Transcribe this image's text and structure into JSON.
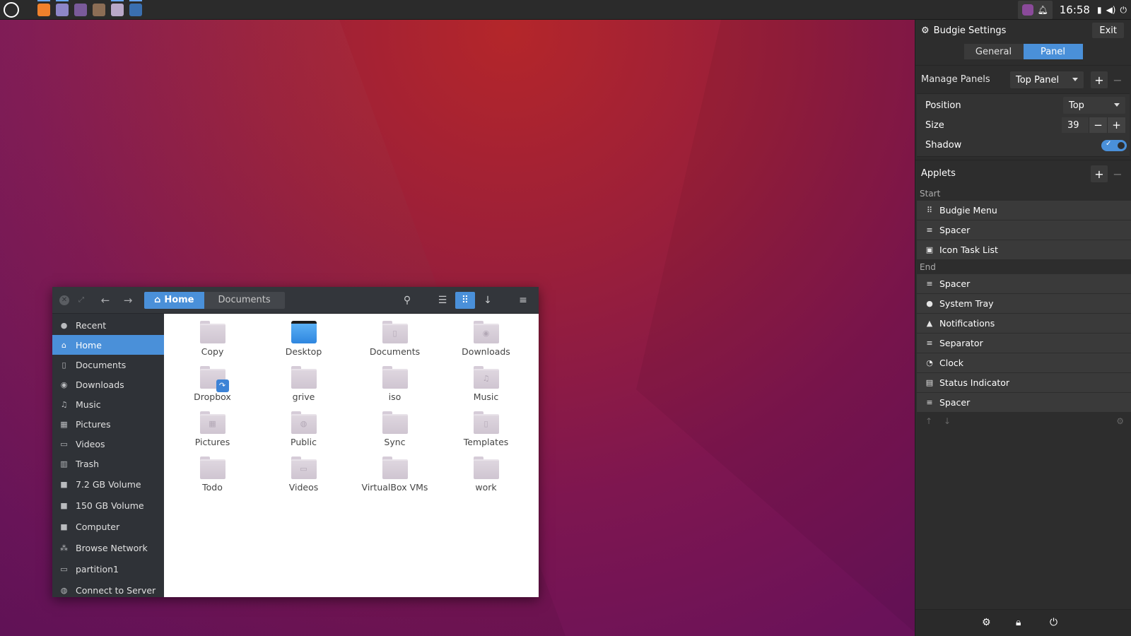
{
  "top_panel": {
    "clock": "16:58",
    "task_icons": [
      {
        "name": "firefox-icon",
        "color": "#f0812c",
        "active": true
      },
      {
        "name": "text-editor-icon",
        "color": "#8e86c8",
        "active": true
      },
      {
        "name": "pidgin-icon",
        "color": "#7a5a9a",
        "active": false
      },
      {
        "name": "photo-app-icon",
        "color": "#8c6d55",
        "active": false
      },
      {
        "name": "file-manager-icon",
        "color": "#b9a8c8",
        "active": true
      },
      {
        "name": "virtualbox-icon",
        "color": "#3a6fb0",
        "active": true
      }
    ]
  },
  "file_manager": {
    "path": {
      "home": "Home",
      "current": "Documents"
    },
    "sidebar": [
      {
        "label": "Recent",
        "icon": "recent-icon",
        "glyph": "●"
      },
      {
        "label": "Home",
        "icon": "home-icon",
        "glyph": "⌂",
        "selected": true
      },
      {
        "label": "Documents",
        "icon": "document-icon",
        "glyph": "▯"
      },
      {
        "label": "Downloads",
        "icon": "download-icon",
        "glyph": "◉"
      },
      {
        "label": "Music",
        "icon": "music-icon",
        "glyph": "♫"
      },
      {
        "label": "Pictures",
        "icon": "pictures-icon",
        "glyph": "▦"
      },
      {
        "label": "Videos",
        "icon": "videos-icon",
        "glyph": "▭"
      },
      {
        "label": "Trash",
        "icon": "trash-icon",
        "glyph": "▥"
      },
      {
        "label": "7.2 GB Volume",
        "icon": "drive-icon",
        "glyph": "■"
      },
      {
        "label": "150 GB Volume",
        "icon": "drive-icon",
        "glyph": "■"
      },
      {
        "label": "Computer",
        "icon": "computer-icon",
        "glyph": "■"
      },
      {
        "label": "Browse Network",
        "icon": "network-icon",
        "glyph": "⁂"
      },
      {
        "label": "partition1",
        "icon": "folder-icon",
        "glyph": "▭"
      },
      {
        "label": "Connect to Server",
        "icon": "server-icon",
        "glyph": "◍"
      }
    ],
    "files": [
      {
        "label": "Copy",
        "emblem": ""
      },
      {
        "label": "Desktop",
        "kind": "desktop"
      },
      {
        "label": "Documents",
        "emblem": "▯"
      },
      {
        "label": "Downloads",
        "emblem": "◉"
      },
      {
        "label": "Dropbox",
        "emblem": "",
        "badge": "↷"
      },
      {
        "label": "grive",
        "emblem": ""
      },
      {
        "label": "iso",
        "emblem": ""
      },
      {
        "label": "Music",
        "emblem": "♫"
      },
      {
        "label": "Pictures",
        "emblem": "▦"
      },
      {
        "label": "Public",
        "emblem": "◍"
      },
      {
        "label": "Sync",
        "emblem": ""
      },
      {
        "label": "Templates",
        "emblem": "▯"
      },
      {
        "label": "Todo",
        "emblem": ""
      },
      {
        "label": "Videos",
        "emblem": "▭"
      },
      {
        "label": "VirtualBox VMs",
        "emblem": ""
      },
      {
        "label": "work",
        "emblem": ""
      }
    ]
  },
  "budgie_settings": {
    "title": "Budgie Settings",
    "exit_label": "Exit",
    "tabs": [
      {
        "label": "General"
      },
      {
        "label": "Panel",
        "selected": true
      }
    ],
    "manage_panels": {
      "label": "Manage Panels",
      "selected": "Top Panel"
    },
    "position": {
      "label": "Position",
      "value": "Top"
    },
    "size": {
      "label": "Size",
      "value": "39"
    },
    "shadow": {
      "label": "Shadow",
      "enabled": true
    },
    "applets_label": "Applets",
    "start_label": "Start",
    "end_label": "End",
    "start_applets": [
      {
        "label": "Budgie Menu",
        "icon": "grid-icon",
        "glyph": "⠿"
      },
      {
        "label": "Spacer",
        "icon": "spacer-icon",
        "glyph": "≡"
      },
      {
        "label": "Icon Task List",
        "icon": "task-list-icon",
        "glyph": "▣"
      }
    ],
    "end_applets": [
      {
        "label": "Spacer",
        "icon": "spacer-icon",
        "glyph": "≡"
      },
      {
        "label": "System Tray",
        "icon": "info-icon",
        "glyph": "●"
      },
      {
        "label": "Notifications",
        "icon": "bell-icon",
        "glyph": "▲"
      },
      {
        "label": "Separator",
        "icon": "separator-icon",
        "glyph": "≡"
      },
      {
        "label": "Clock",
        "icon": "clock-icon",
        "glyph": "◔"
      },
      {
        "label": "Status Indicator",
        "icon": "status-icon",
        "glyph": "▤"
      },
      {
        "label": "Spacer",
        "icon": "spacer-icon",
        "glyph": "≡"
      }
    ]
  }
}
